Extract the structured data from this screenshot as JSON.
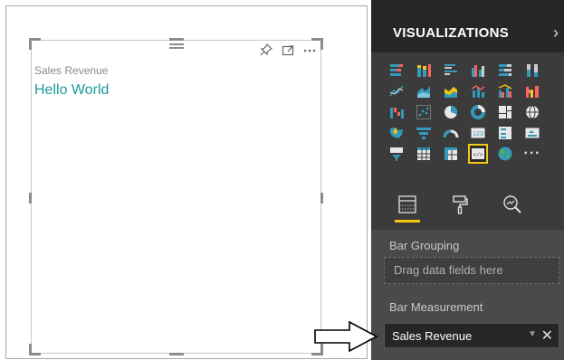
{
  "visual": {
    "title": "Sales Revenue",
    "content": "Hello World"
  },
  "panel": {
    "title": "VISUALIZATIONS",
    "collapse_glyph": "›"
  },
  "fields": {
    "bar_grouping_label": "Bar Grouping",
    "bar_grouping_placeholder": "Drag data fields here",
    "bar_measurement_label": "Bar Measurement",
    "bar_measurement_value": "Sales Revenue",
    "remove_glyph": "✕",
    "caret_glyph": "▼"
  },
  "gallery": {
    "more_glyph": "···",
    "selected_icon": "custom-visual-icon"
  },
  "colors": {
    "teal": "#1c9b9b",
    "yellow": "#f2c811",
    "panel_bg": "#3b3b3b",
    "panel_header": "#262626"
  }
}
